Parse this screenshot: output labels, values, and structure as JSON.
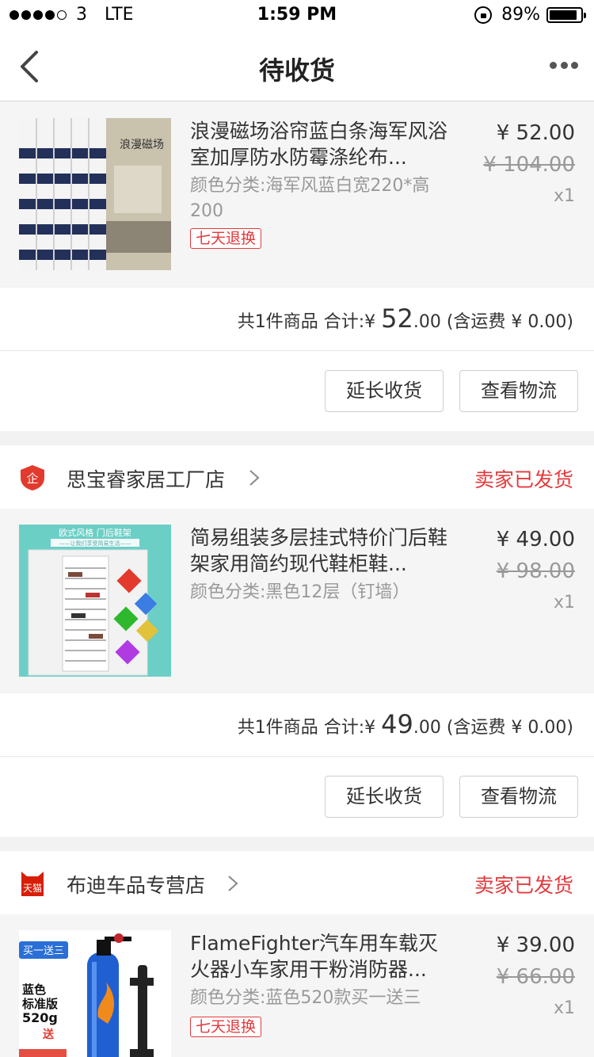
{
  "status_bar": {
    "carrier": "3",
    "network": "LTE",
    "time": "1:59 PM",
    "battery": "89%",
    "battery_level": 0.89
  },
  "nav": {
    "title": "待收货"
  },
  "orders": [
    {
      "product": {
        "title": "浪漫磁场浴帘蓝白条海军风浴室加厚防水防霉涤纶布...",
        "sku": "颜色分类:海军风蓝白宽220*高200",
        "tag": "七天退换",
        "price": "¥ 52.00",
        "original_price": "¥ 104.00",
        "qty": "x1",
        "image_text": "浪漫磁场"
      },
      "summary": {
        "prefix": "共1件商品 合计:¥ ",
        "amount_int": "52",
        "amount_dec": ".00",
        "shipping": " (含运费 ¥ 0.00)"
      },
      "buttons": {
        "extend": "延长收货",
        "logistics": "查看物流"
      }
    },
    {
      "shop": {
        "name": "思宝睿家居工厂店",
        "status": "卖家已发货",
        "icon_text": "企"
      },
      "product": {
        "title": "简易组装多层挂式特价门后鞋架家用简约现代鞋柜鞋...",
        "sku": "颜色分类:黑色12层（钉墙）",
        "price": "¥ 49.00",
        "original_price": "¥ 98.00",
        "qty": "x1",
        "image_title": "欧式风格 门后鞋架",
        "image_sub": "——让我们享受简易生活——"
      },
      "summary": {
        "prefix": "共1件商品 合计:¥ ",
        "amount_int": "49",
        "amount_dec": ".00",
        "shipping": " (含运费 ¥ 0.00)"
      },
      "buttons": {
        "extend": "延长收货",
        "logistics": "查看物流"
      }
    },
    {
      "shop": {
        "name": "布迪车品专营店",
        "status": "卖家已发货",
        "icon_text": "天猫"
      },
      "product": {
        "title": "FlameFighter汽车用车载灭火器小车家用干粉消防器...",
        "sku": "颜色分类:蓝色520款买一送三",
        "tag": "七天退换",
        "price": "¥ 39.00",
        "original_price": "¥ 66.00",
        "qty": "x1",
        "image_badge": "买一送三",
        "image_lines": [
          "蓝色",
          "标准版",
          "520g",
          "送"
        ]
      }
    }
  ]
}
